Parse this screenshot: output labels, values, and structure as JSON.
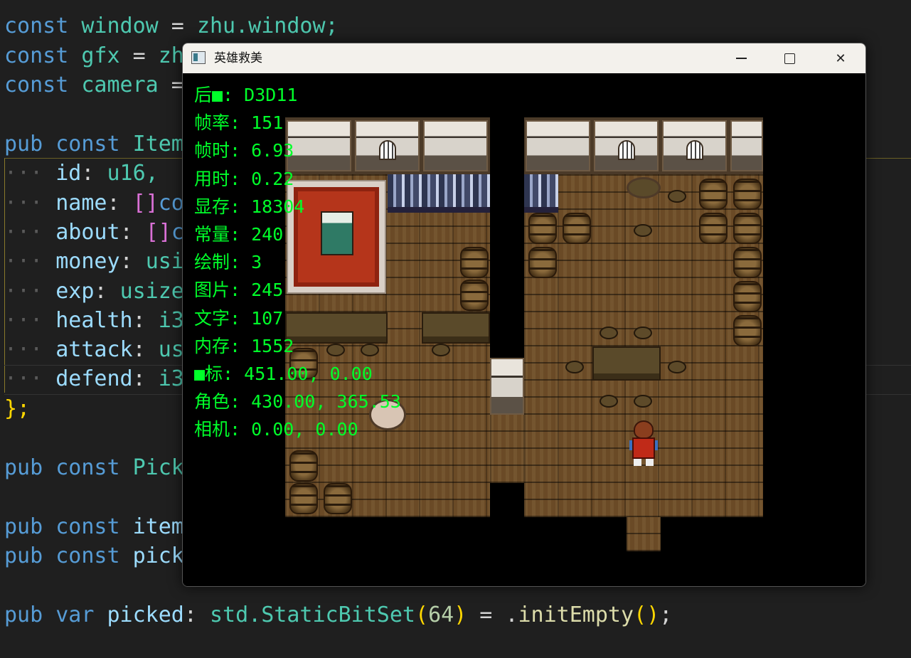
{
  "editor": {
    "lines": [
      {
        "kw": "const",
        "name": "window",
        "rest": " = ",
        "val": "zhu.window;"
      },
      {
        "kw": "const",
        "name": "gfx",
        "rest": " = ",
        "val": "zh"
      },
      {
        "kw": "const",
        "name": "camera",
        "rest": " =",
        "val": ""
      },
      {
        "kw": "pub const",
        "name": "Item",
        "rest": "",
        "val": ""
      },
      {
        "dots": "···",
        "field": "id",
        "sep": ": ",
        "type": "u16,"
      },
      {
        "dots": "···",
        "field": "name",
        "sep": ": ",
        "br": "[]",
        "type": "co"
      },
      {
        "dots": "···",
        "field": "about",
        "sep": ": ",
        "br": "[]",
        "type": "c"
      },
      {
        "dots": "···",
        "field": "money",
        "sep": ": ",
        "type": "usi"
      },
      {
        "dots": "···",
        "field": "exp",
        "sep": ": ",
        "type": "usize"
      },
      {
        "dots": "···",
        "field": "health",
        "sep": ": ",
        "type": "i3"
      },
      {
        "dots": "···",
        "field": "attack",
        "sep": ": ",
        "type": "us"
      },
      {
        "dots": "···",
        "field": "defend",
        "sep": ": ",
        "type": "i3"
      },
      {
        "close": "};"
      },
      {
        "kw": "pub const",
        "name": "Pick",
        "rest": "",
        "val": ""
      },
      {
        "kw": "pub const",
        "name": "item",
        "rest": "",
        "val": ""
      },
      {
        "kw": "pub const",
        "name": "pick",
        "rest": "",
        "val": ""
      }
    ],
    "last_line": {
      "kw": "pub var",
      "name": "picked",
      "colon": ": ",
      "ns": "std.",
      "type": "StaticBitSet",
      "open": "(",
      "num": "64",
      "close": ")",
      "eq": " = ",
      "dot": ".",
      "fn": "initEmpty",
      "call": "()",
      "semi": ";"
    }
  },
  "window": {
    "title": "英雄救美",
    "icon": "app-icon",
    "controls": {
      "minimize": "minimize-icon",
      "maximize": "maximize-icon",
      "close": "close-icon",
      "close_glyph": "✕"
    }
  },
  "debug": {
    "color": "#00ff2a",
    "lines": [
      "后■: D3D11",
      "帧率: 151",
      "帧时: 6.93",
      "用时: 0.22",
      "显存: 18304",
      "常量: 240",
      "绘制: 3",
      "图片: 245",
      "文字: 107",
      "内存: 1552",
      "■标: 451.00, 0.00",
      "角色: 430.00, 365.53",
      "相机: 0.00, 0.00"
    ]
  }
}
